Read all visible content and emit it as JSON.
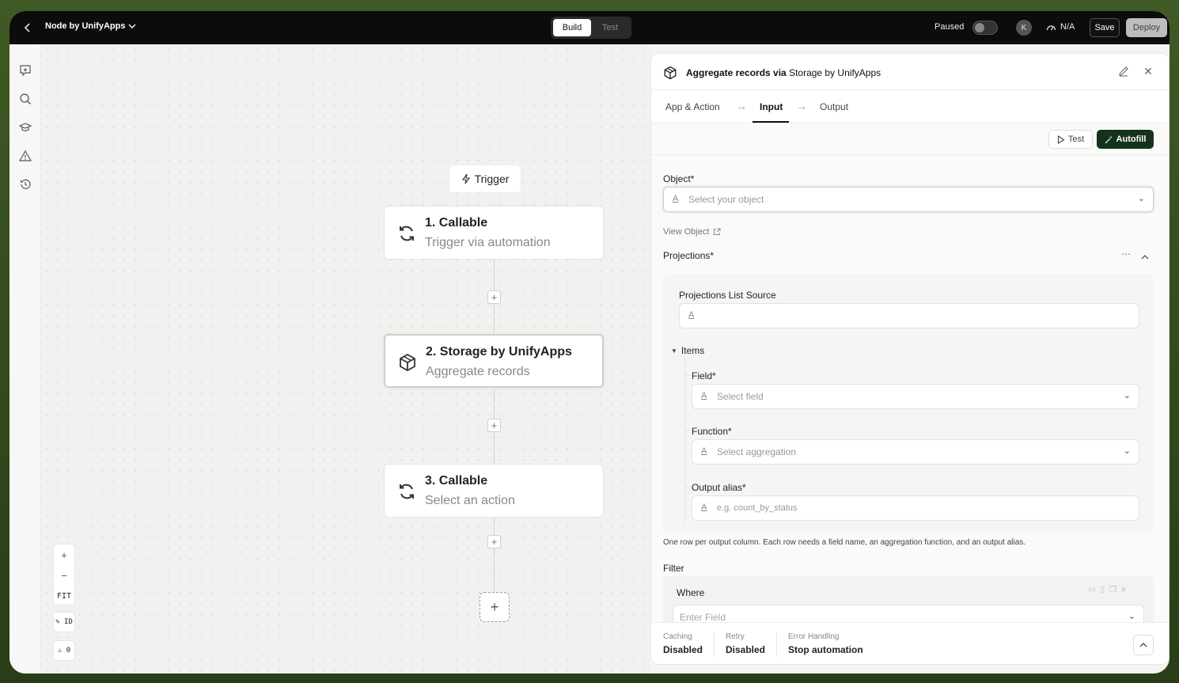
{
  "topbar": {
    "title": "Node by UnifyApps",
    "tab_build": "Build",
    "tab_test": "Test",
    "paused_label": "Paused",
    "avatar_initial": "K",
    "na_label": "N/A",
    "save_label": "Save",
    "deploy_label": "Deploy"
  },
  "canvas": {
    "trigger_label": "Trigger",
    "nodes": [
      {
        "title": "1. Callable",
        "subtitle": "Trigger via automation",
        "icon": "sync-icon"
      },
      {
        "title": "2. Storage by UnifyApps",
        "subtitle": "Aggregate records",
        "icon": "box-icon"
      },
      {
        "title": "3. Callable",
        "subtitle": "Select an action",
        "icon": "sync-icon"
      }
    ],
    "zoom_in": "+",
    "zoom_out": "−",
    "zoom_fit": "FIT",
    "chip_id": "✎ ID",
    "chip_warn": "⚠ 0"
  },
  "panel": {
    "title_prefix": "Aggregate records via",
    "title_app": "Storage by UnifyApps",
    "tabs": [
      "App & Action",
      "Input",
      "Output"
    ],
    "active_tab": "Input",
    "test_label": "Test",
    "autofill_label": "Autofill",
    "object_label": "Object*",
    "object_placeholder": "Select your object",
    "view_object": "View Object",
    "projections_label": "Projections*",
    "proj_list_source": "Projections List Source",
    "items_label": "Items",
    "field_label": "Field*",
    "field_placeholder": "Select field",
    "function_label": "Function*",
    "function_placeholder": "Select aggregation",
    "alias_label": "Output alias*",
    "alias_placeholder": "e.g. count_by_status",
    "hint": "One row per output column. Each row needs a field name, an aggregation function, and an output alias.",
    "filter_label": "Filter",
    "where_label": "Where",
    "enter_field": "Enter Field",
    "footer": [
      {
        "k": "Caching",
        "v": "Disabled"
      },
      {
        "k": "Retry",
        "v": "Disabled"
      },
      {
        "k": "Error Handling",
        "v": "Stop automation"
      }
    ]
  }
}
